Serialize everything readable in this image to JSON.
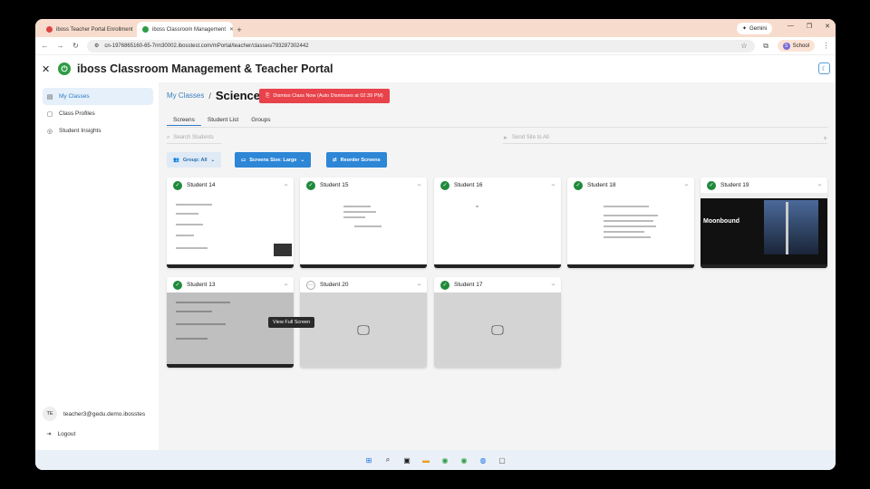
{
  "browser": {
    "tabs": [
      {
        "label": "iboss Teacher Portal Enrollment",
        "active": false
      },
      {
        "label": "iboss Classroom Management",
        "active": true
      }
    ],
    "url": "cn-1976865160-65-7rm30002.ibosstest.com/mPortal/teacher/classes/793287302442",
    "gemini_label": "Gemini",
    "profile_label": "School",
    "profile_initial": "S"
  },
  "app": {
    "title": "iboss Classroom Management & Teacher Portal"
  },
  "sidebar": {
    "items": [
      {
        "label": "My Classes",
        "icon": "classes-icon",
        "active": true
      },
      {
        "label": "Class Profiles",
        "icon": "profiles-icon",
        "active": false
      },
      {
        "label": "Student Insights",
        "icon": "insights-icon",
        "active": false
      }
    ],
    "user_initials": "TE",
    "user_email": "teacher3@gedu.demo.ibosstes",
    "logout_label": "Logout"
  },
  "main": {
    "breadcrumb_link": "My Classes",
    "breadcrumb_sep": "/",
    "class_name": "Science",
    "dismiss_label": "Dismiss Class Now (Auto Dismisses at 02:39 PM)",
    "tabs": [
      "Screens",
      "Student List",
      "Groups"
    ],
    "search_placeholder": "Search Students",
    "send_placeholder": "Send Site to All",
    "group_label": "Group: All",
    "screen_size_label": "Screens Size: Large",
    "reorder_label": "Reorder Screens",
    "tooltip": "View Full Screen",
    "students": [
      {
        "name": "Student 14",
        "online": true
      },
      {
        "name": "Student 15",
        "online": true
      },
      {
        "name": "Student 16",
        "online": true
      },
      {
        "name": "Student 18",
        "online": true
      },
      {
        "name": "Student 19",
        "online": true
      },
      {
        "name": "Student 13",
        "online": true
      },
      {
        "name": "Student 20",
        "online": false
      },
      {
        "name": "Student 17",
        "online": true
      }
    ],
    "student19_screen_text": "Moonbound"
  },
  "colors": {
    "accent": "#2d86d6",
    "danger": "#e8424a",
    "online": "#1f8a3b",
    "logo": "#2e9b45"
  }
}
